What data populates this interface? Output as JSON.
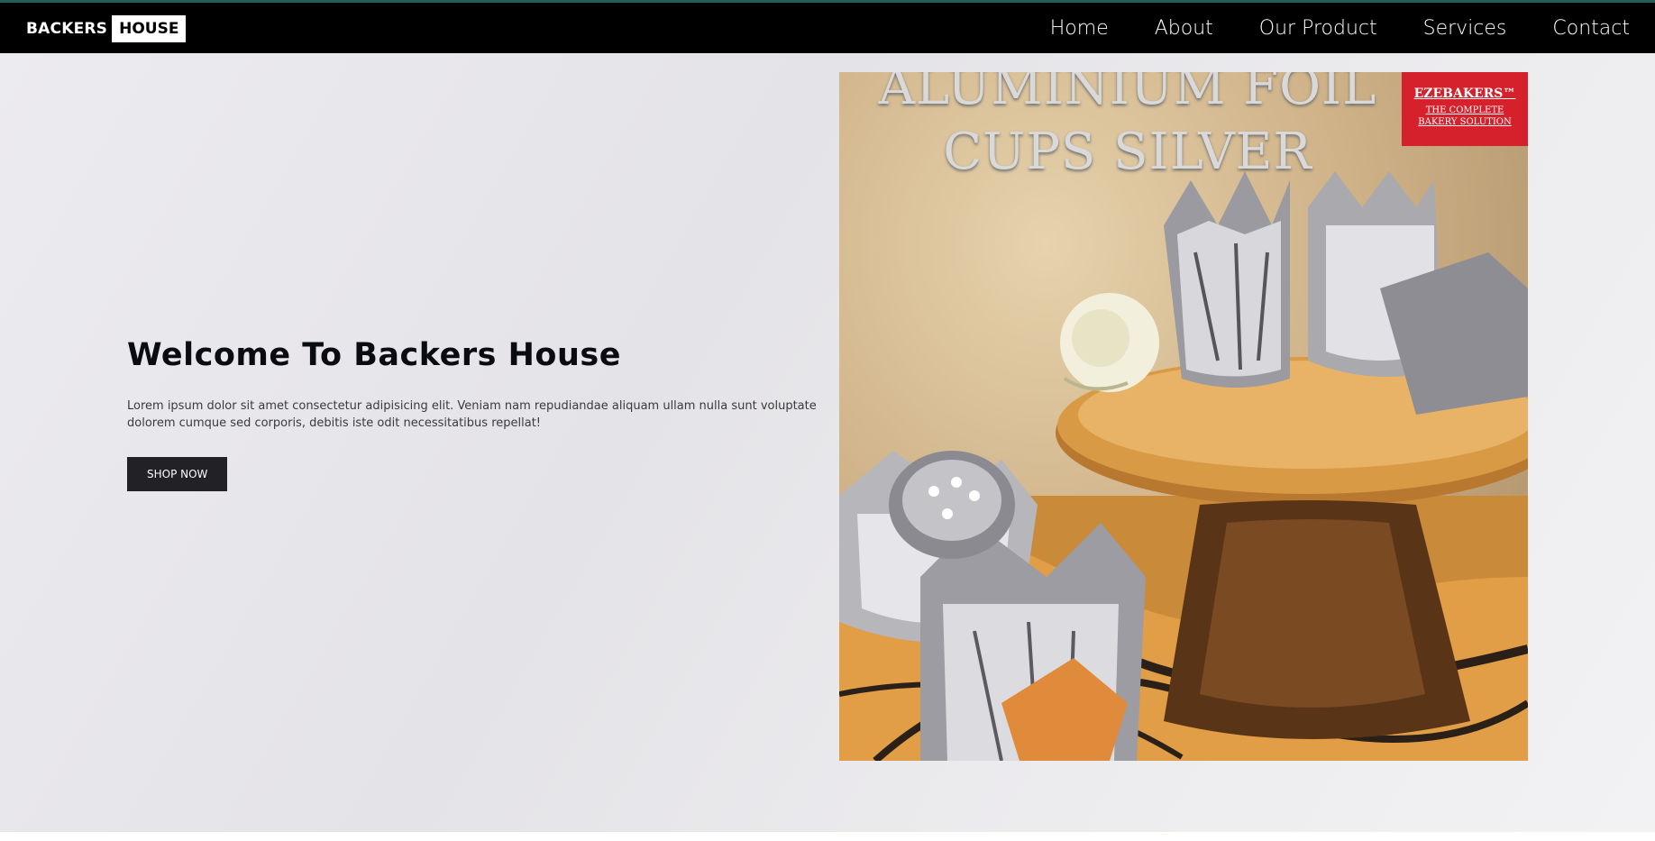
{
  "brand": {
    "part1": "BACKERS",
    "part2": "HOUSE"
  },
  "nav": {
    "items": [
      {
        "label": "Home"
      },
      {
        "label": "About"
      },
      {
        "label": "Our Product"
      },
      {
        "label": "Services"
      },
      {
        "label": "Contact"
      }
    ]
  },
  "hero": {
    "title": "Welcome To Backers House",
    "description": "Lorem ipsum dolor sit amet consectetur adipisicing elit. Veniam nam repudiandae aliquam ullam nulla sunt voluptate dolorem cumque sed corporis, debitis iste odit necessitatibus repellat!",
    "button": "SHOP NOW"
  },
  "product_image": {
    "caption_line1": "ALUMINIUM FOIL",
    "caption_line2": "CUPS SILVER",
    "badge_name": "EZEBAKERS™",
    "badge_tagline": "THE COMPLETE BAKERY SOLUTION"
  },
  "colors": {
    "navbar": "#000000",
    "top_accent": "#1f5f5c",
    "button": "#212126",
    "badge": "#d4212b"
  }
}
